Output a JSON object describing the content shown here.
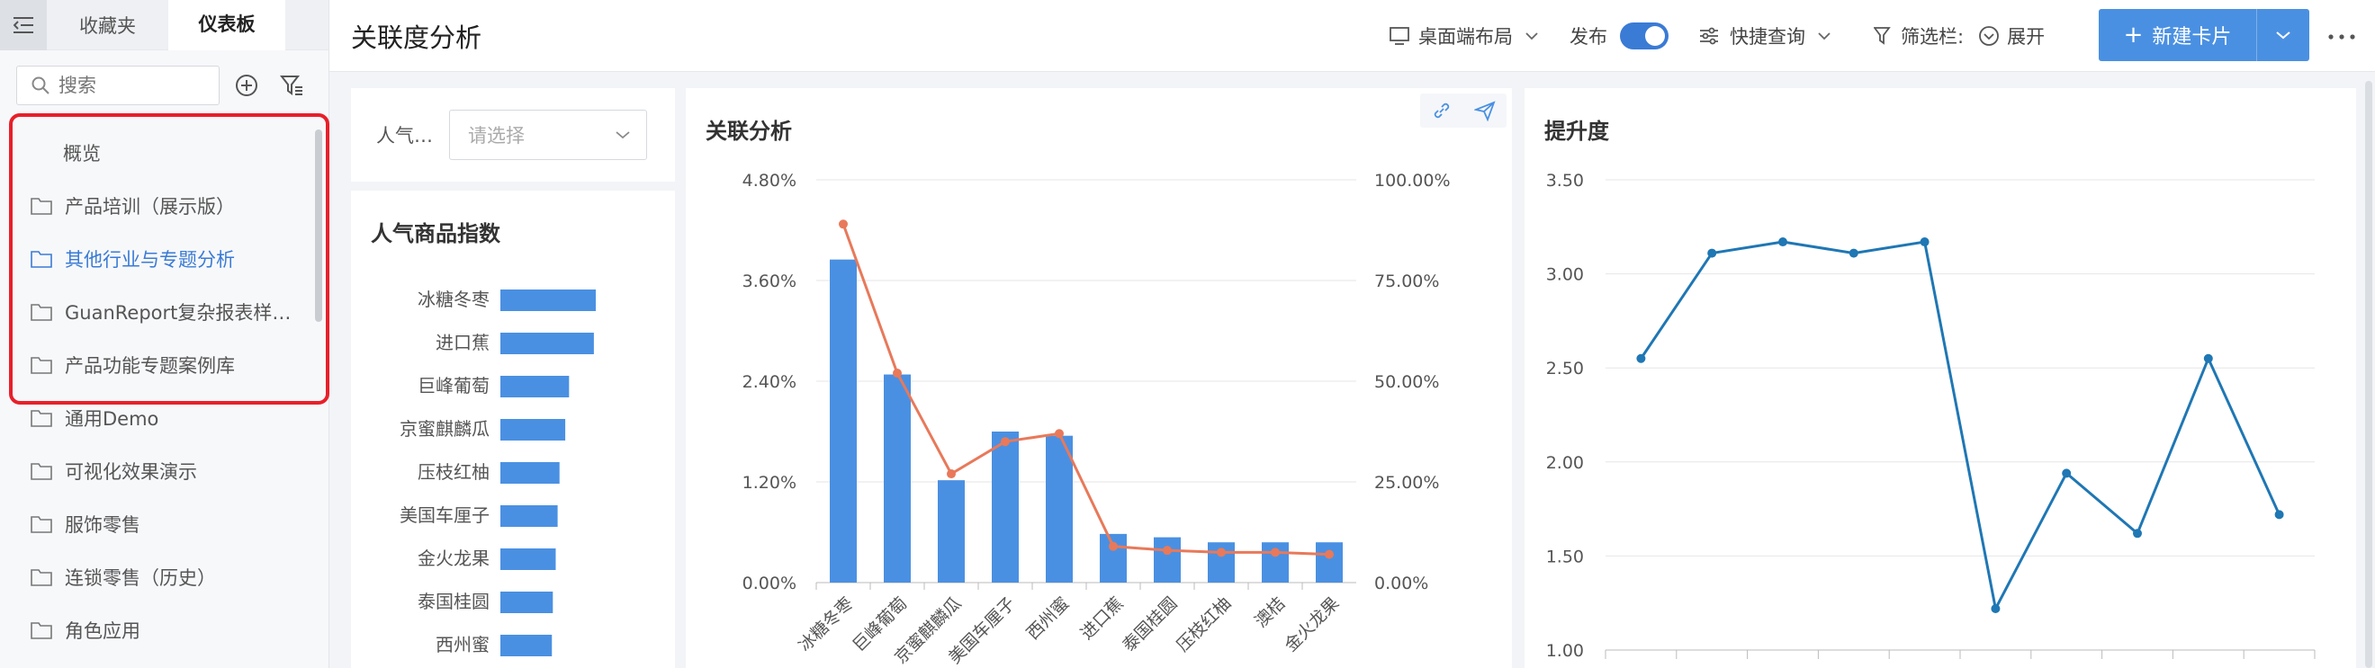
{
  "sidebar": {
    "tabs": [
      {
        "label": "收藏夹"
      },
      {
        "label": "仪表板"
      }
    ],
    "search_placeholder": "搜索",
    "items": [
      {
        "label": "概览"
      },
      {
        "label": "产品培训（展示版）"
      },
      {
        "label": "其他行业与专题分析"
      },
      {
        "label": "GuanReport复杂报表样…"
      },
      {
        "label": "产品功能专题案例库"
      },
      {
        "label": "通用Demo"
      },
      {
        "label": "可视化效果演示"
      },
      {
        "label": "服饰零售"
      },
      {
        "label": "连锁零售（历史）"
      },
      {
        "label": "角色应用"
      }
    ]
  },
  "topbar": {
    "title": "关联度分析",
    "layout_label": "桌面端布局",
    "publish_label": "发布",
    "quick_query_label": "快捷查询",
    "filter_bar_label": "筛选栏:",
    "expand_label": "展开",
    "new_card_label": "新建卡片"
  },
  "filter": {
    "label": "人气…",
    "placeholder": "请选择"
  },
  "colors": {
    "accent": "#4a90e2",
    "line_orange": "#e8795a",
    "line_blue": "#1f77b4",
    "highlight_red": "#e8202a"
  },
  "chart_data": [
    {
      "type": "bar",
      "title": "人气商品指数",
      "orientation": "horizontal",
      "categories": [
        "冰糖冬枣",
        "进口蕉",
        "巨峰葡萄",
        "京蜜麒麟瓜",
        "压枝红柚",
        "美国车厘子",
        "金火龙果",
        "泰国桂圆",
        "西州蜜"
      ],
      "values": [
        100,
        98,
        72,
        68,
        62,
        60,
        58,
        55,
        54
      ]
    },
    {
      "type": "bar",
      "title": "关联分析",
      "categories": [
        "冰糖冬枣",
        "巨峰葡萄",
        "京蜜麒麟瓜",
        "美国车厘子",
        "西州蜜",
        "进口蕉",
        "泰国桂圆",
        "压枝红柚",
        "澳桔",
        "金火龙果"
      ],
      "series": [
        {
          "type": "bar",
          "axis": "left",
          "values": [
            3.85,
            2.48,
            1.22,
            1.8,
            1.75,
            0.58,
            0.54,
            0.48,
            0.48,
            0.48
          ]
        },
        {
          "type": "line",
          "axis": "right",
          "values": [
            0.89,
            0.52,
            0.27,
            0.35,
            0.37,
            0.09,
            0.08,
            0.075,
            0.075,
            0.07
          ]
        }
      ],
      "ylim_left": [
        0,
        4.8
      ],
      "ylim_right": [
        0,
        1.0
      ],
      "left_ticks": [
        "0.00%",
        "1.20%",
        "2.40%",
        "3.60%",
        "4.80%"
      ],
      "right_ticks": [
        "0.00%",
        "25.00%",
        "50.00%",
        "75.00%",
        "100.00%"
      ]
    },
    {
      "type": "line",
      "title": "提升度",
      "values": [
        2.55,
        3.11,
        3.17,
        3.11,
        3.17,
        1.22,
        1.94,
        1.62,
        2.55,
        1.72
      ],
      "ylim": [
        1.0,
        3.5
      ],
      "ticks": [
        "1.00",
        "1.50",
        "2.00",
        "2.50",
        "3.00",
        "3.50"
      ]
    }
  ]
}
